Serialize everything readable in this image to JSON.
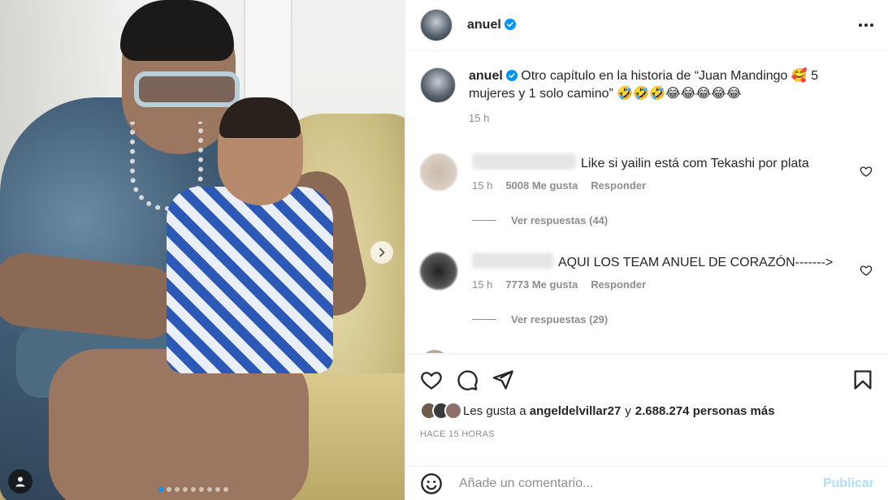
{
  "post": {
    "username": "anuel",
    "verified": true
  },
  "caption": {
    "username": "anuel",
    "text": "Otro capítulo en la historia de “Juan Mandingo 🥰 5 mujeres y 1 solo camino” 🤣🤣🤣😂😂😂😂😂",
    "time": "15 h"
  },
  "comments": [
    {
      "text": "Like si yailin está com Tekashi por plata",
      "time": "15 h",
      "likes": "5008 Me gusta",
      "reply": "Responder",
      "view_replies": "Ver respuestas (44)"
    },
    {
      "text": "AQUI LOS TEAM ANUEL DE CORAZÓN------->",
      "time": "15 h",
      "likes": "7773 Me gusta",
      "reply": "Responder",
      "view_replies": "Ver respuestas (29)"
    }
  ],
  "likes": {
    "prefix": "Les gusta a",
    "user": "angeldelvillar27",
    "connector": "y",
    "count": "2.688.274 personas más"
  },
  "time_ago": "HACE 15 HORAS",
  "add_comment": {
    "placeholder": "Añade un comentario...",
    "publish": "Publicar"
  },
  "carousel": {
    "total_slides": 9,
    "active_index": 0
  },
  "colors": {
    "accent": "#0095f6",
    "publish_disabled": "#b2dffc",
    "muted": "#8e8e8e"
  },
  "icons": [
    "more-icon",
    "verified-icon",
    "heart-icon",
    "comment-icon",
    "share-icon",
    "bookmark-icon",
    "emoji-icon",
    "chevron-right-icon",
    "user-tag-icon"
  ]
}
